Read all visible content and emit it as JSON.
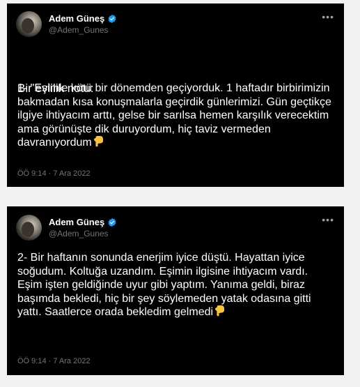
{
  "tweets": [
    {
      "author": {
        "display_name": "Adem Güneş",
        "handle": "@Adem_Gunes"
      },
      "title": "Bir evlilik notu:",
      "text": "1- \"Eşimle kötü bir dönemden geçiyorduk. 1 haftadır birbirimizin bakmadan kısa konuşmalarla geçirdik günlerimizi. Gün geçtikçe ilgiye ihtiyacım arttı, gelse bir sarılsa hemen karşılık verecektim ama görünüşte dik duruyordum, hiç taviz vermeden davranıyordum",
      "emoji": "pointing-down-hand-icon",
      "timestamp": "ÖÖ 9:14 · 7 Ara 2022"
    },
    {
      "author": {
        "display_name": "Adem Güneş",
        "handle": "@Adem_Gunes"
      },
      "text": "2- Bir haftanın sonunda enerjim iyice düştü. Hayattan iyice soğudum. Koltuğa uzandım. Eşimin ilgisine ihtiyacım vardı. Eşim işten geldiğinde uyur gibi yaptım. Yanıma geldi, biraz başımda bekledi, hiç bir şey söylemeden yatak odasına gitti yattı. Saatlerce orada bekledim gelmedi",
      "emoji": "pointing-down-hand-icon",
      "timestamp": "ÖÖ 9:14 · 7 Ara 2022"
    }
  ],
  "colors": {
    "tweet_bg": "#000000",
    "text": "#ffffff",
    "secondary_text": "#6f767b",
    "verified": "#1d9bf0",
    "emoji": "#f5c242"
  }
}
